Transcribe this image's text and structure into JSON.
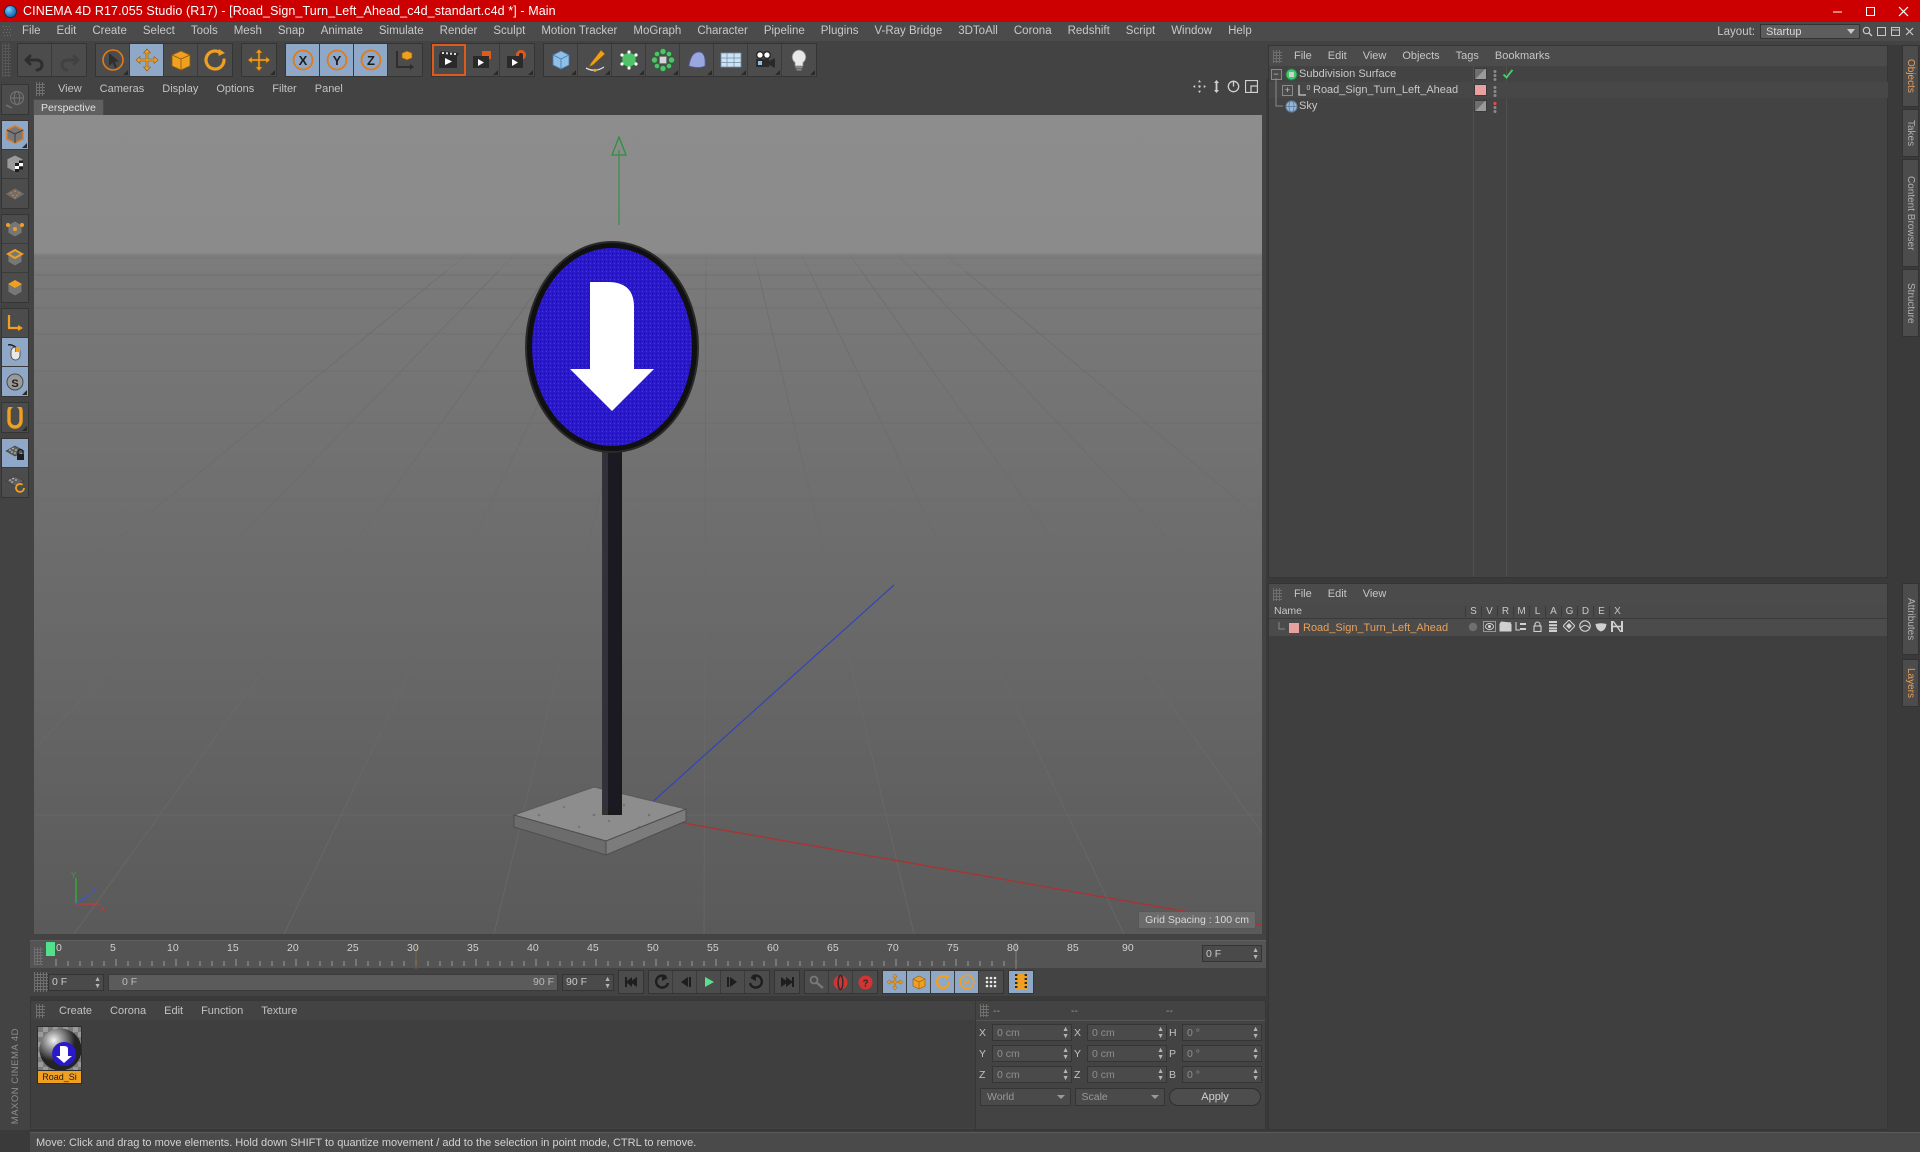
{
  "titlebar": {
    "title": "CINEMA 4D R17.055 Studio (R17) - [Road_Sign_Turn_Left_Ahead_c4d_standart.c4d *] - Main",
    "minimize": "–",
    "maximize": "❐",
    "close": "✕"
  },
  "menubar": {
    "items": [
      "File",
      "Edit",
      "Create",
      "Select",
      "Tools",
      "Mesh",
      "Snap",
      "Animate",
      "Simulate",
      "Render",
      "Sculpt",
      "Motion Tracker",
      "MoGraph",
      "Character",
      "Pipeline",
      "Plugins",
      "V-Ray Bridge",
      "3DToAll",
      "Corona",
      "Redshift",
      "Script",
      "Window",
      "Help"
    ],
    "layout_label": "Layout:",
    "layout_value": "Startup"
  },
  "viewport": {
    "menu": [
      "View",
      "Cameras",
      "Display",
      "Options",
      "Filter",
      "Panel"
    ],
    "tab": "Perspective",
    "grid_spacing": "Grid Spacing : 100 cm",
    "axis_labels": {
      "y": "Y",
      "x": "X",
      "z": "Z"
    }
  },
  "timeline": {
    "ticks": [
      "0",
      "5",
      "10",
      "15",
      "20",
      "25",
      "30",
      "35",
      "40",
      "45",
      "50",
      "55",
      "60",
      "65",
      "70",
      "75",
      "80",
      "85",
      "90"
    ],
    "current_frame": "0 F",
    "range_start": "0 F",
    "range_end": "90 F",
    "end_frame_field": "90 F",
    "preview_end": "0 F",
    "doc_end": "90 F"
  },
  "material_manager": {
    "menu": [
      "Create",
      "Corona",
      "Edit",
      "Function",
      "Texture"
    ],
    "materials": [
      {
        "name": "Road_Si"
      }
    ]
  },
  "coordinates": {
    "header": [
      "--",
      "--",
      "--"
    ],
    "position": [
      {
        "label": "X",
        "value": "0 cm"
      },
      {
        "label": "Y",
        "value": "0 cm"
      },
      {
        "label": "Z",
        "value": "0 cm"
      }
    ],
    "size": [
      {
        "label": "X",
        "value": "0 cm"
      },
      {
        "label": "Y",
        "value": "0 cm"
      },
      {
        "label": "Z",
        "value": "0 cm"
      }
    ],
    "rotation": [
      {
        "label": "H",
        "value": "0 °"
      },
      {
        "label": "P",
        "value": "0 °"
      },
      {
        "label": "B",
        "value": "0 °"
      }
    ],
    "coord_system": "World",
    "mode": "Scale",
    "apply": "Apply"
  },
  "object_manager": {
    "menu": [
      "File",
      "Edit",
      "View",
      "Objects",
      "Tags",
      "Bookmarks"
    ],
    "objects": [
      {
        "name": "Subdivision Surface",
        "depth": 0,
        "icon": "subdivision-surface-icon",
        "tag_check": true,
        "dot": "grey"
      },
      {
        "name": "Road_Sign_Turn_Left_Ahead",
        "depth": 1,
        "icon": "null-object-icon",
        "swatch": "#e8a0a0",
        "dot": "grey"
      },
      {
        "name": "Sky",
        "depth": 0,
        "icon": "sky-icon",
        "dot": "red"
      }
    ]
  },
  "layer_manager": {
    "menu": [
      "File",
      "Edit",
      "View"
    ],
    "columns": [
      "Name",
      "S",
      "V",
      "R",
      "M",
      "L",
      "A",
      "G",
      "D",
      "E",
      "X"
    ],
    "rows": [
      {
        "name": "Road_Sign_Turn_Left_Ahead",
        "swatch": "#e8a0a0"
      }
    ]
  },
  "right_tabs": {
    "upper": [
      "Objects",
      "Takes",
      "Content Browser",
      "Structure"
    ],
    "upper_active": "Objects",
    "lower": [
      "Attributes",
      "Layers"
    ],
    "lower_active": "Layers"
  },
  "left_brand": "MAXON CINEMA 4D",
  "status_bar": {
    "message": "Move: Click and drag to move elements. Hold down SHIFT to quantize movement / add to the selection in point mode, CTRL to remove."
  },
  "colors": {
    "title_bar": "#cc0000",
    "accent_orange": "#f0a020",
    "highlight_blue": "#90a8c8",
    "sign_blue": "#2a19c8",
    "panel_bg": "#434343"
  }
}
